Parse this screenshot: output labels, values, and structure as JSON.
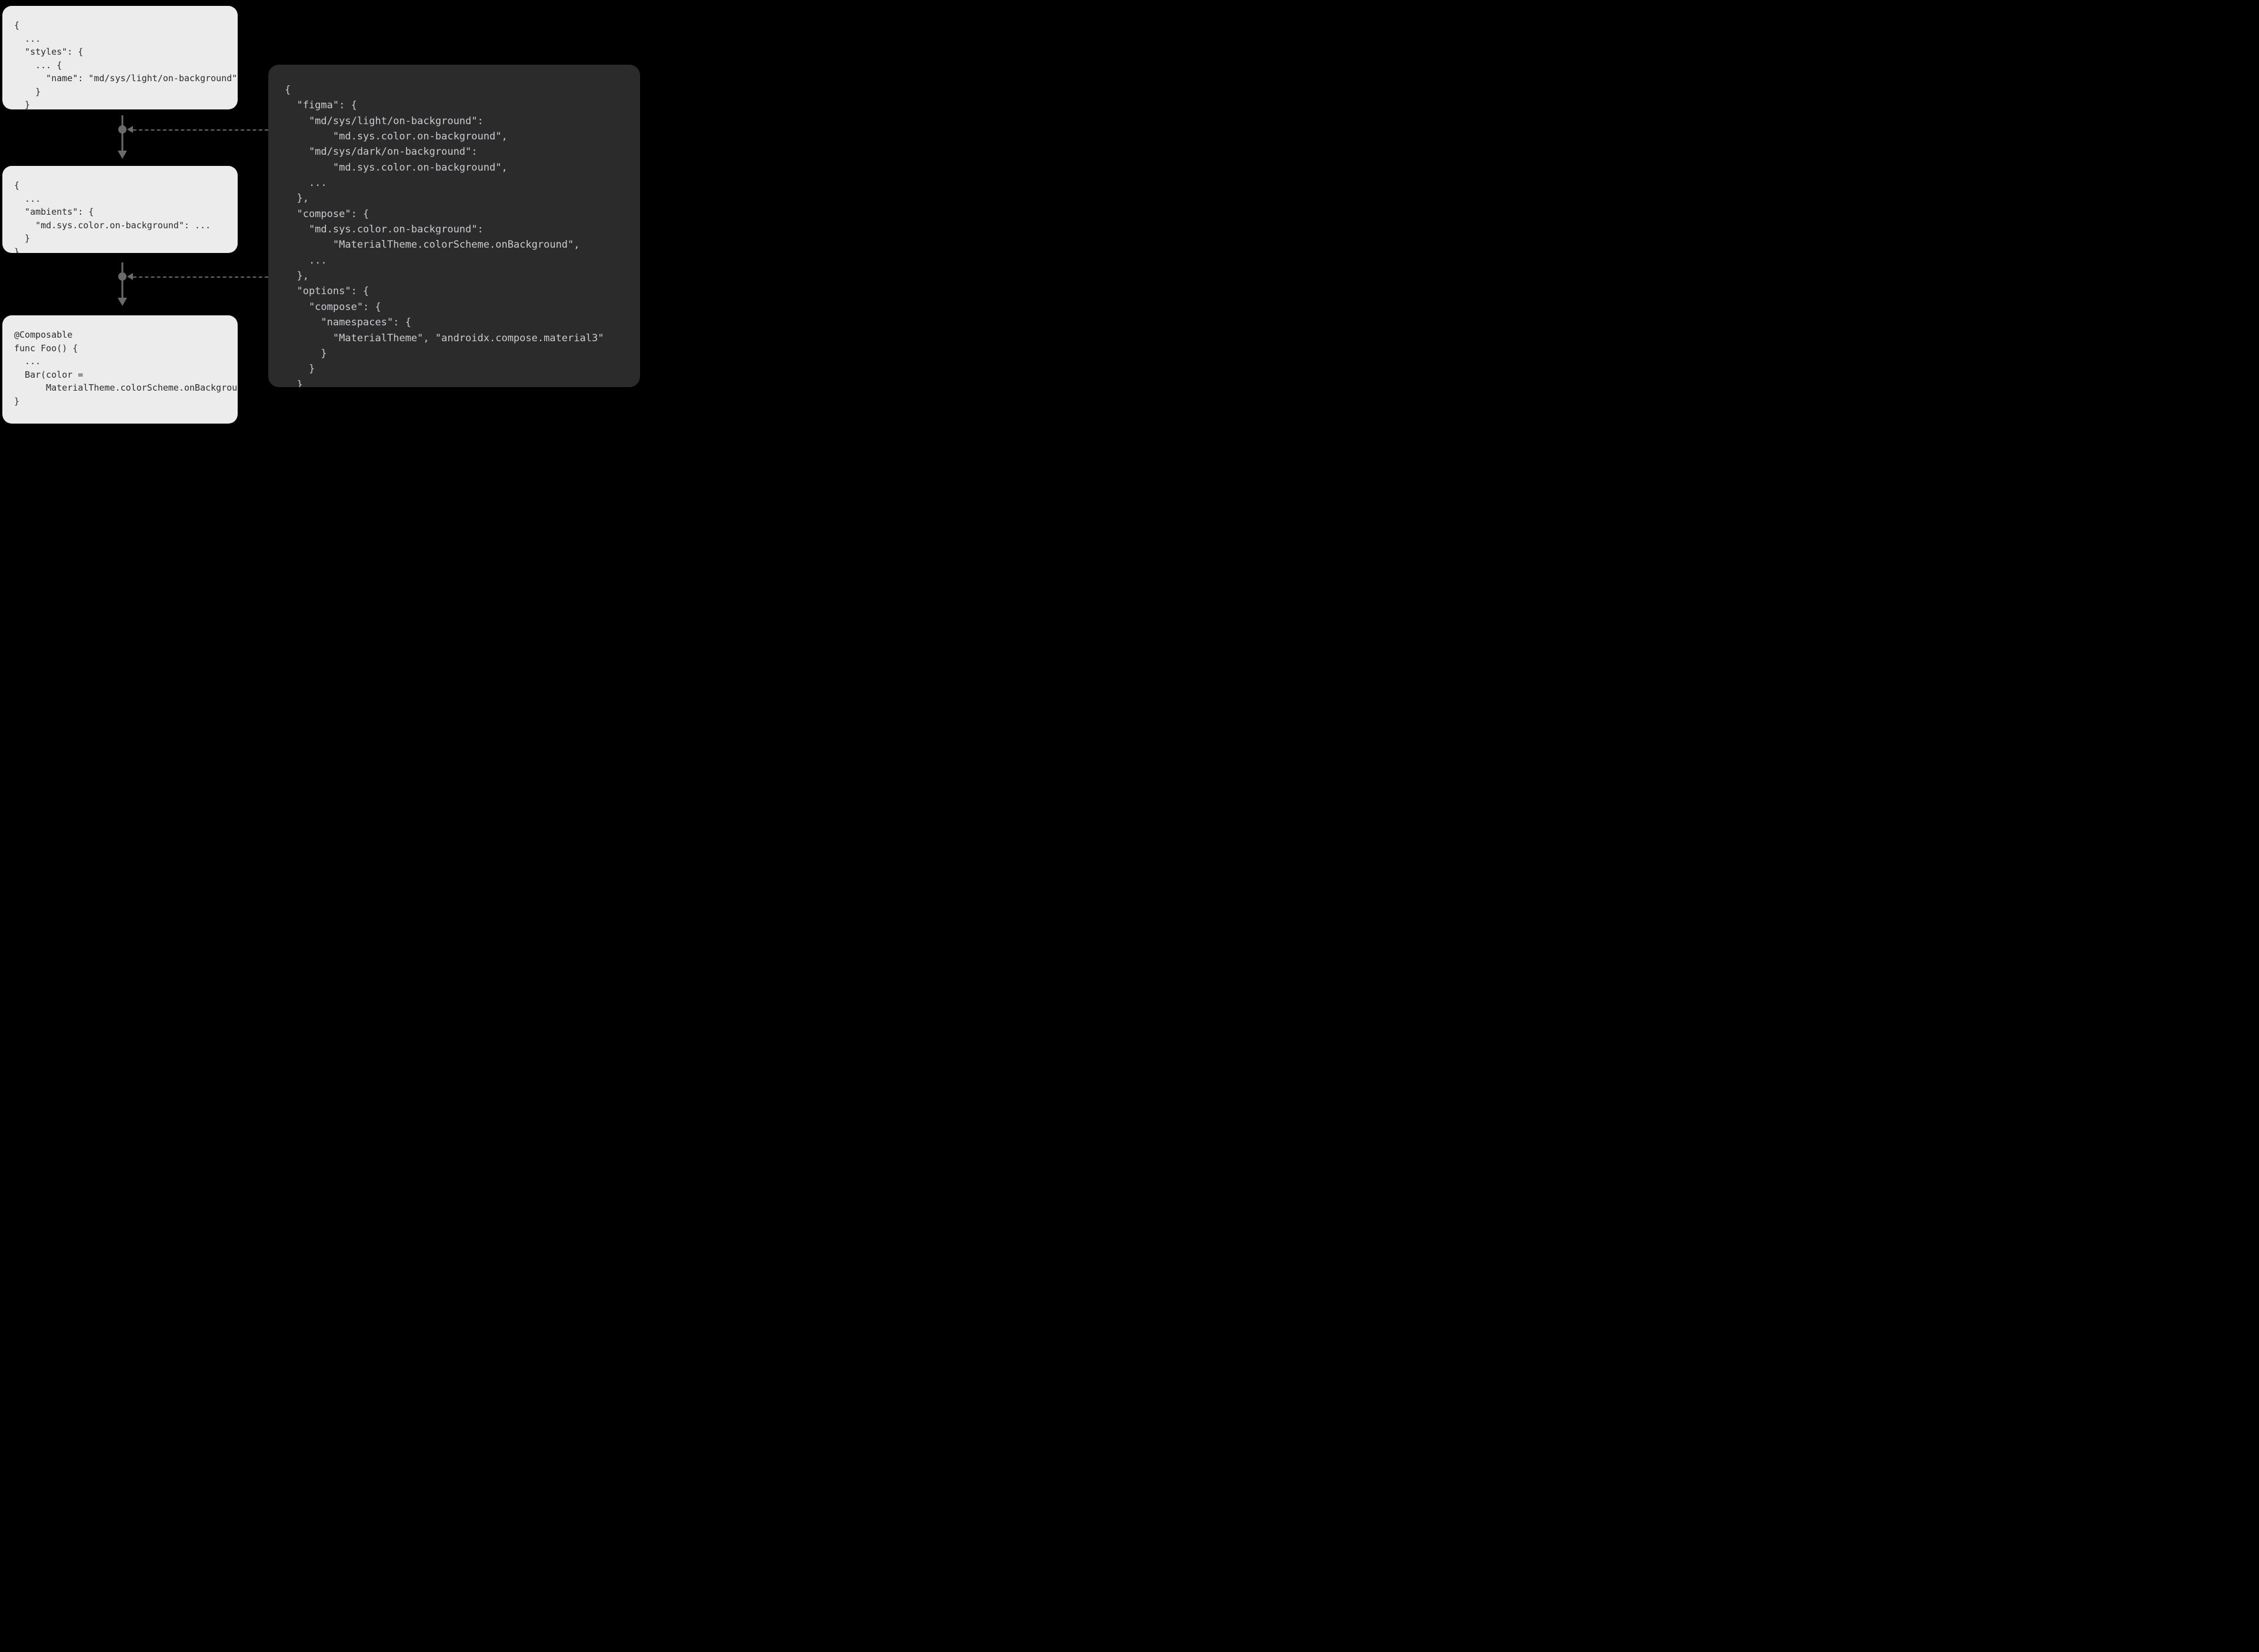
{
  "cards": {
    "styles_json": "{\n  ...\n  \"styles\": {\n    ... {\n      \"name\": \"md/sys/light/on-background\",\n    }\n  }\n}",
    "ambients_json": "{\n  ...\n  \"ambients\": {\n    \"md.sys.color.on-background\": ...\n  }\n}",
    "compose_code": "@Composable\nfunc Foo() {\n  ...\n  Bar(color =\n      MaterialTheme.colorScheme.onBackground)\n}",
    "mapping_json": "{\n  \"figma\": {\n    \"md/sys/light/on-background\":\n        \"md.sys.color.on-background\",\n    \"md/sys/dark/on-background\":\n        \"md.sys.color.on-background\",\n    ...\n  },\n  \"compose\": {\n    \"md.sys.color.on-background\":\n        \"MaterialTheme.colorScheme.onBackground\",\n    ...\n  },\n  \"options\": {\n    \"compose\": {\n      \"namespaces\": {\n        \"MaterialTheme\", \"androidx.compose.material3\"\n      }\n    }\n  }\n}"
  },
  "colors": {
    "bg": "#000000",
    "light_card_bg": "#ececec",
    "light_card_fg": "#2b2b2b",
    "dark_card_bg": "#2b2b2b",
    "dark_card_fg": "#c9ccd1",
    "arrow": "#6a6a6a"
  }
}
